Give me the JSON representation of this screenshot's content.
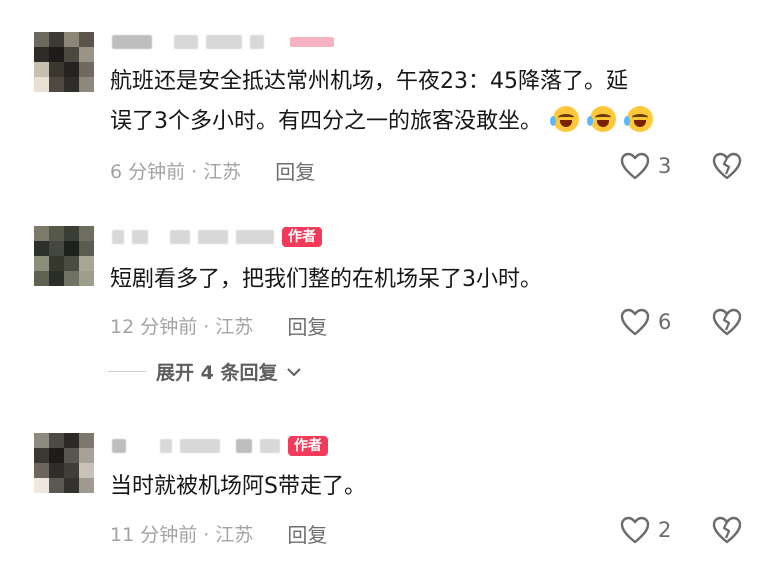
{
  "comments": [
    {
      "text_line1": "航班还是安全抵达常州机场，午夜23：45降落了。延",
      "text_line2": "误了3个多小时。有四分之一的旅客没敢坐。",
      "time": "6 分钟前 · 江苏",
      "reply_label": "回复",
      "likes": "3",
      "emoji_name": "crying-laughing-emoji"
    },
    {
      "author_tag": "作者",
      "text_line1": "短剧看多了，把我们整的在机场呆了3小时。",
      "time": "12 分钟前 · 江苏",
      "reply_label": "回复",
      "likes": "6"
    },
    {
      "author_tag": "作者",
      "text_line1": "当时就被机场阿S带走了。",
      "time": "11 分钟前 · 江苏",
      "reply_label": "回复",
      "likes": "2"
    }
  ],
  "expand_replies": {
    "label": "展开 4 条回复"
  },
  "colors": {
    "accent": "#f23a5a",
    "meta_gray": "#a3a3a3",
    "text": "#161616"
  }
}
